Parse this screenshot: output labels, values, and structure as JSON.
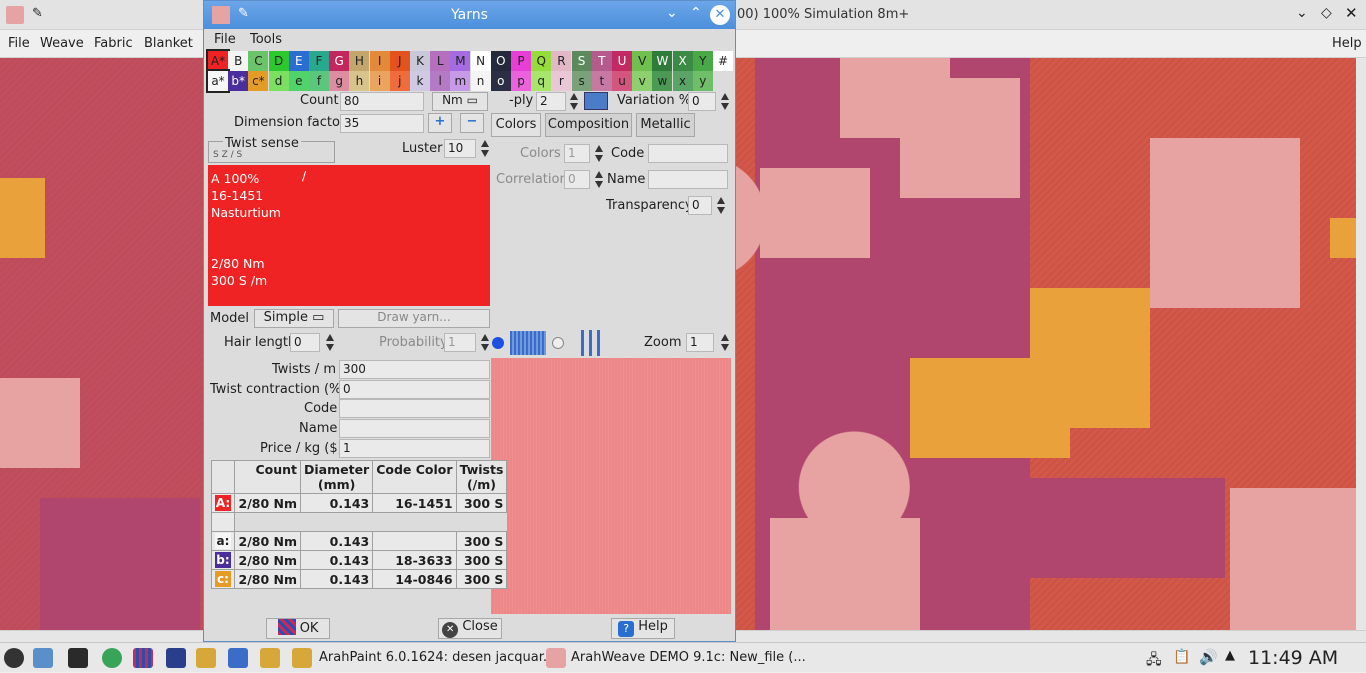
{
  "main_window": {
    "title": "00) 100% Simulation 8m+",
    "menu": [
      "File",
      "Weave",
      "Fabric",
      "Blanket",
      "Help"
    ]
  },
  "dialog": {
    "title": "Yarns",
    "menu": [
      "File",
      "Tools"
    ],
    "swatches_upper": [
      {
        "label": "A*",
        "color": "#ef2323"
      },
      {
        "label": "B",
        "color": "#f4f4f4"
      },
      {
        "label": "C",
        "color": "#6cc46a"
      },
      {
        "label": "D",
        "color": "#2dc82d"
      },
      {
        "label": "E",
        "color": "#2a6fd0"
      },
      {
        "label": "F",
        "color": "#28a88c"
      },
      {
        "label": "G",
        "color": "#c2285e"
      },
      {
        "label": "H",
        "color": "#c3a66e"
      },
      {
        "label": "I",
        "color": "#e28a3a"
      },
      {
        "label": "J",
        "color": "#e4531e"
      },
      {
        "label": "K",
        "color": "#c8c8d8"
      },
      {
        "label": "L",
        "color": "#b66fbd"
      },
      {
        "label": "M",
        "color": "#a56be0"
      },
      {
        "label": "N",
        "color": "#ffffff"
      },
      {
        "label": "O",
        "color": "#222a3c"
      },
      {
        "label": "P",
        "color": "#e83dd6"
      },
      {
        "label": "Q",
        "color": "#96dc3c"
      },
      {
        "label": "R",
        "color": "#e2b7c6"
      },
      {
        "label": "S",
        "color": "#5c8a5c"
      },
      {
        "label": "T",
        "color": "#b45a8c"
      },
      {
        "label": "U",
        "color": "#c22a63"
      },
      {
        "label": "V",
        "color": "#6fc04e"
      },
      {
        "label": "W",
        "color": "#2f7c3a"
      },
      {
        "label": "X",
        "color": "#3b8a45"
      },
      {
        "label": "Y",
        "color": "#49a947"
      },
      {
        "label": "#",
        "color": "#ffffff"
      }
    ],
    "swatches_lower": [
      {
        "label": "a*",
        "color": "#f6f6f6"
      },
      {
        "label": "b*",
        "color": "#4a2e9c"
      },
      {
        "label": "c*",
        "color": "#e39d26"
      },
      {
        "label": "d",
        "color": "#7be061"
      },
      {
        "label": "e",
        "color": "#51d26b"
      },
      {
        "label": "f",
        "color": "#5bc77c"
      },
      {
        "label": "g",
        "color": "#dc8ea0"
      },
      {
        "label": "h",
        "color": "#d7c38c"
      },
      {
        "label": "i",
        "color": "#e9a45e"
      },
      {
        "label": "j",
        "color": "#ef6d3c"
      },
      {
        "label": "k",
        "color": "#cfc9e3"
      },
      {
        "label": "l",
        "color": "#b47ac6"
      },
      {
        "label": "m",
        "color": "#c69ae6"
      },
      {
        "label": "n",
        "color": "#f4f4f4"
      },
      {
        "label": "o",
        "color": "#2a2f45"
      },
      {
        "label": "p",
        "color": "#ec62dc"
      },
      {
        "label": "q",
        "color": "#a7e66b"
      },
      {
        "label": "r",
        "color": "#e9c7d4"
      },
      {
        "label": "s",
        "color": "#7aa17a"
      },
      {
        "label": "t",
        "color": "#c679a3"
      },
      {
        "label": "u",
        "color": "#d4557e"
      },
      {
        "label": "v",
        "color": "#8ed06e"
      },
      {
        "label": "w",
        "color": "#4a9a54"
      },
      {
        "label": "x",
        "color": "#5aa465"
      },
      {
        "label": "y",
        "color": "#6fbf6a"
      }
    ],
    "count_label": "Count",
    "count_value": "80",
    "count_unit": "Nm",
    "ply_label": "-ply",
    "ply_value": "2",
    "variation_label": "Variation %",
    "variation_value": "0",
    "dimension_label": "Dimension factor",
    "dimension_value": "35",
    "twist_sense_label": "Twist sense",
    "twist_sense_options": "S Z / S",
    "luster_label": "Luster",
    "luster_value": "10",
    "tabs": [
      "Colors",
      "Composition",
      "Metallic"
    ],
    "colors_label": "Colors",
    "colors_value": "1",
    "correlation_label": "Correlation",
    "correlation_value": "0",
    "code_label": "Code",
    "code_value": "",
    "name_label": "Name",
    "name_value": "",
    "transparency_label": "Transparency",
    "transparency_value": "0",
    "preview": {
      "color": "#ef2323",
      "line1": "A 100%",
      "line2": "16-1451",
      "line3": "Nasturtium",
      "line4": "2/80 Nm",
      "line5": "300 S /m",
      "slash": "/"
    },
    "model_label": "Model",
    "model_value": "Simple",
    "draw_yarn_label": "Draw yarn...",
    "hair_length_label": "Hair length",
    "hair_length_value": "0",
    "probability_label": "Probability",
    "probability_value": "1",
    "zoom_label": "Zoom",
    "zoom_value": "1",
    "twists_label": "Twists / m",
    "twists_value": "300",
    "contraction_label": "Twist contraction (%)",
    "contraction_value": "0",
    "code2_label": "Code",
    "code2_value": "",
    "name2_label": "Name",
    "name2_value": "",
    "price_label": "Price / kg ($)",
    "price_value": "1",
    "table": {
      "headers": [
        "Count",
        "Diameter (mm)",
        "Code Color",
        "Twists (/m)"
      ],
      "rows": [
        {
          "tag": "A:",
          "tag_color": "#ef2323",
          "count": "2/80 Nm",
          "diameter": "0.143",
          "code": "16-1451",
          "twists": "300 S"
        },
        {
          "tag": "a:",
          "tag_color": "#f6f6f6",
          "count": "2/80 Nm",
          "diameter": "0.143",
          "code": "",
          "twists": "300 S"
        },
        {
          "tag": "b:",
          "tag_color": "#4a2e9c",
          "count": "2/80 Nm",
          "diameter": "0.143",
          "code": "18-3633",
          "twists": "300 S"
        },
        {
          "tag": "c:",
          "tag_color": "#e39d26",
          "count": "2/80 Nm",
          "diameter": "0.143",
          "code": "14-0846",
          "twists": "300 S"
        }
      ]
    },
    "ok_label": "OK",
    "close_label": "Close",
    "help_label": "Help"
  },
  "taskbar": {
    "task1": "ArahPaint 6.0.1624: desen jacquar...",
    "task2": "ArahWeave DEMO 9.1c: New_file (...",
    "clock": "11:49 AM"
  }
}
